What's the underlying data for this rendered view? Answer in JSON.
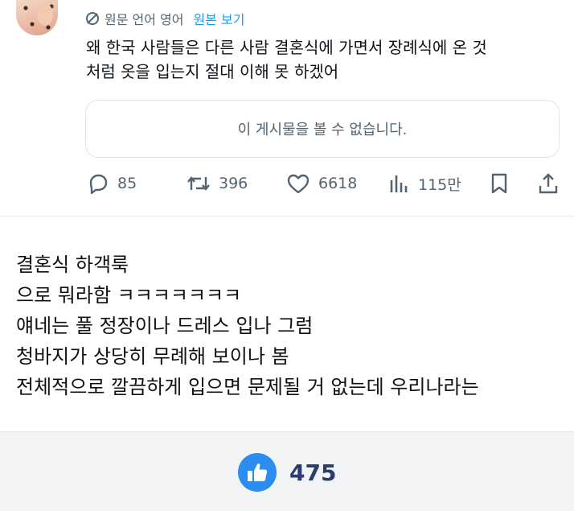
{
  "tweet": {
    "translation_label": "원문 언어 영어",
    "show_original_label": "원본 보기",
    "text_lines": [
      "왜 한국 사람들은 다른 사람 결혼식에 가면서 장례식에 온 것",
      "처럼 옷을 입는지 절대 이해 못 하겠어"
    ],
    "unavailable_text": "이 게시물을 볼 수 없습니다.",
    "actions": {
      "replies": "85",
      "retweets": "396",
      "likes": "6618",
      "views": "115만"
    }
  },
  "comment": {
    "lines": [
      "결혼식 하객룩",
      "으로 뭐라함 ㅋㅋㅋㅋㅋㅋㅋ",
      "얘네는 풀 정장이나 드레스 입나 그럼",
      "청바지가 상당히 무례해 보이나 봄",
      "전체적으로 깔끔하게 입으면 문제될 거 없는데 우리나라는"
    ]
  },
  "footer": {
    "like_count": "475"
  },
  "colors": {
    "link_blue": "#1d9bf0",
    "muted_gray": "#536471",
    "like_blue": "#2d8cf0",
    "like_count": "#2a3b6e"
  }
}
